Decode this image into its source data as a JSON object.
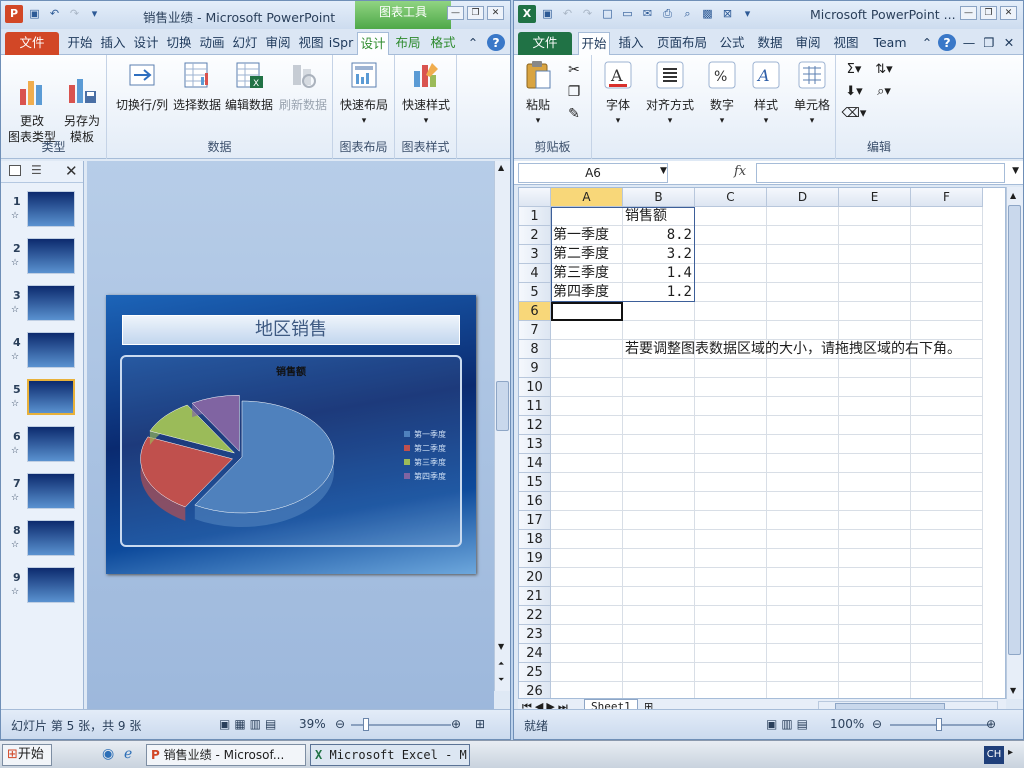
{
  "ppt": {
    "title": "销售业绩 - Microsoft PowerPoint",
    "context_tools": "图表工具",
    "tabs": [
      "文件",
      "开始",
      "插入",
      "设计",
      "切换",
      "动画",
      "幻灯",
      "审阅",
      "视图",
      "iSpr",
      "设计",
      "布局",
      "格式"
    ],
    "ribbon": {
      "btn_change_type": "更改\n图表类型",
      "btn_save_template": "另存为\n模板",
      "btn_switch_rowcol": "切换行/列",
      "btn_select_data": "选择数据",
      "btn_edit_data": "编辑数据",
      "btn_refresh_data": "刷新数据",
      "btn_quick_layout": "快速布局",
      "btn_quick_style": "快速样式",
      "group_type": "类型",
      "group_data": "数据",
      "group_layout": "图表布局",
      "group_style": "图表样式"
    },
    "thumbnails": [
      "1",
      "2",
      "3",
      "4",
      "5",
      "6",
      "7",
      "8",
      "9"
    ],
    "slide": {
      "title": "地区销售",
      "chart_title": "销售额"
    },
    "status": {
      "slide_info": "幻灯片 第 5 张，共 9 张",
      "zoom": "39%"
    },
    "chart_data": {
      "type": "pie",
      "title": "销售额",
      "categories": [
        "第一季度",
        "第二季度",
        "第三季度",
        "第四季度"
      ],
      "values": [
        8.2,
        3.2,
        1.4,
        1.2
      ],
      "colors": [
        "#4f81bd",
        "#c0504d",
        "#9bbb59",
        "#8064a2"
      ],
      "legend_position": "right"
    }
  },
  "xl": {
    "title": "Microsoft PowerPoint ...",
    "tabs": [
      "文件",
      "开始",
      "插入",
      "页面布局",
      "公式",
      "数据",
      "审阅",
      "视图",
      "Team"
    ],
    "ribbon": {
      "btn_paste": "粘贴",
      "btn_font": "字体",
      "btn_align": "对齐方式",
      "btn_number": "数字",
      "btn_style": "样式",
      "btn_cells": "单元格",
      "group_clipboard": "剪贴板",
      "group_edit": "编辑"
    },
    "namebox": "A6",
    "fx": "fx",
    "columns": [
      "A",
      "B",
      "C",
      "D",
      "E",
      "F"
    ],
    "rows": [
      "1",
      "2",
      "3",
      "4",
      "5",
      "6",
      "7",
      "8",
      "9",
      "10",
      "11",
      "12",
      "13",
      "14",
      "15",
      "16",
      "17",
      "18",
      "19",
      "20",
      "21",
      "22",
      "23",
      "24",
      "25",
      "26"
    ],
    "cells": {
      "B1": "销售额",
      "A2": "第一季度",
      "B2": "8.2",
      "A3": "第二季度",
      "B3": "3.2",
      "A4": "第三季度",
      "B4": "1.4",
      "A5": "第四季度",
      "B5": "1.2",
      "B8": "若要调整图表数据区域的大小，请拖拽区域的右下角。"
    },
    "sheet_tab": "Sheet1",
    "status": {
      "ready": "就绪",
      "zoom": "100%"
    }
  },
  "taskbar": {
    "start": "开始",
    "item_ppt": "销售业绩 - Microsof...",
    "item_xl": "Microsoft Excel - M...",
    "ime": "CH"
  }
}
